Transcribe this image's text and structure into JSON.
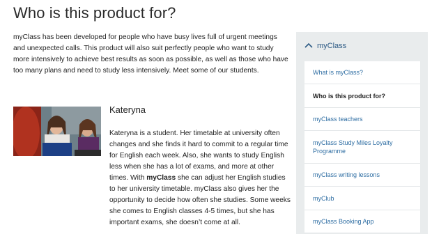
{
  "page": {
    "title": "Who is this product for?",
    "intro": "myClass has been developed for people who have busy lives full of urgent meetings and unexpected calls. This product will also suit perfectly people who want to study more intensively to achieve best results as soon as possible, as well as those who have too many plans and need to study less intensively. Meet some of our students."
  },
  "profile": {
    "name": "Kateryna",
    "text_part1": "Kateryna is a student. Her timetable at university often changes and she finds it hard to commit to a regular time for English each week. Also, she wants to study English less when she has a lot of exams, and more at other times. With ",
    "text_bold": "myClass",
    "text_part2": " she can adjust her English studies to her university timetable. myClass also gives her the opportunity to decide how often she studies. Some weeks she comes to English classes 4-5 times, but she has important exams, she doesn’t come at all."
  },
  "sidebar": {
    "header": "myClass",
    "header_icon": "chevron-up-icon",
    "accent_color": "#2c5a84",
    "items": [
      {
        "label": "What is myClass?"
      },
      {
        "label": "Who is this product for?"
      },
      {
        "label": "myClass teachers"
      },
      {
        "label": "myClass Study Miles Loyalty Programme"
      },
      {
        "label": "myClass writing lessons"
      },
      {
        "label": "myClub"
      },
      {
        "label": "myClass Booking App"
      }
    ],
    "active_item": "Who is this product for?"
  }
}
